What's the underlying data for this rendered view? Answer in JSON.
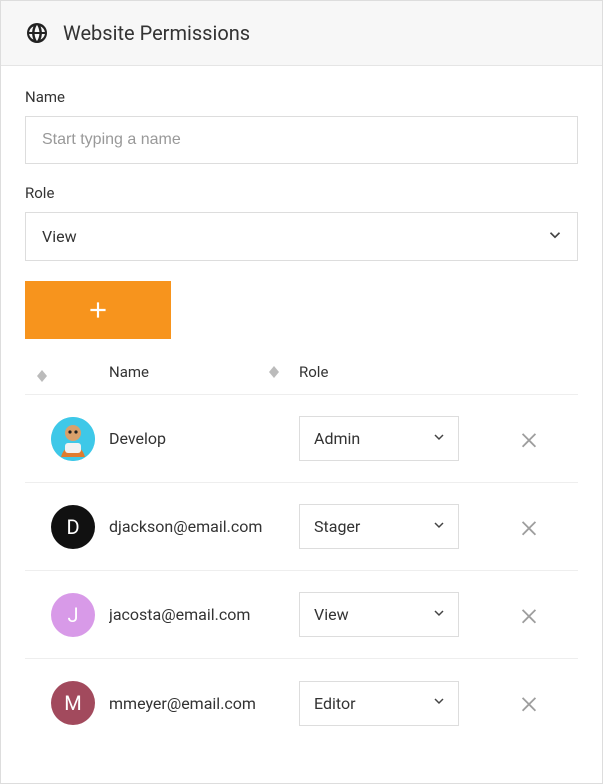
{
  "header": {
    "title": "Website Permissions",
    "icon": "globe-icon"
  },
  "form": {
    "name_label": "Name",
    "name_placeholder": "Start typing a name",
    "name_value": "",
    "role_label": "Role",
    "role_value": "View",
    "add_icon": "plus-icon"
  },
  "table": {
    "columns": {
      "name": "Name",
      "role": "Role"
    },
    "rows": [
      {
        "avatar_type": "image",
        "avatar_letter": "",
        "avatar_bg": "#3ec8e8",
        "name": "Develop",
        "role": "Admin"
      },
      {
        "avatar_type": "letter",
        "avatar_letter": "D",
        "avatar_bg": "#111111",
        "name": "djackson@email.com",
        "role": "Stager"
      },
      {
        "avatar_type": "letter",
        "avatar_letter": "J",
        "avatar_bg": "#d89ae8",
        "name": "jacosta@email.com",
        "role": "View"
      },
      {
        "avatar_type": "letter",
        "avatar_letter": "M",
        "avatar_bg": "#a24a5d",
        "name": "mmeyer@email.com",
        "role": "Editor"
      }
    ]
  },
  "icons": {
    "remove": "close-icon",
    "chevron": "chevron-down-icon",
    "sort": "sort-icon"
  }
}
